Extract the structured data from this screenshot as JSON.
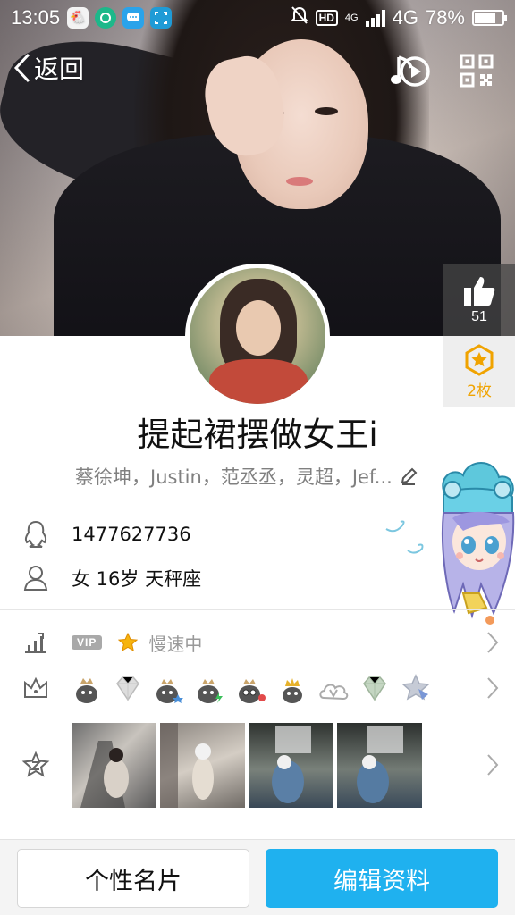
{
  "status_bar": {
    "time": "13:05",
    "hd": "HD",
    "network_small": "4G",
    "network": "4G",
    "battery": "78%",
    "battery_level": 0.78
  },
  "nav": {
    "back_label": "返回"
  },
  "side": {
    "like_count": "51",
    "badge_count": "2枚"
  },
  "profile": {
    "nickname": "提起裙摆做女王i",
    "tags": "蔡徐坤，Justin，范丞丞，灵超，Jef..."
  },
  "info": {
    "qq_number": "1477627736",
    "gender_age_sign": "女  16岁  天秤座"
  },
  "features": {
    "vip_label": "VIP",
    "speed_text": "慢速中"
  },
  "badges": [
    {
      "icon": "penguin-crown-badge-icon"
    },
    {
      "icon": "diamond-badge-icon"
    },
    {
      "icon": "penguin-star-badge-icon"
    },
    {
      "icon": "penguin-lightning-badge-icon"
    },
    {
      "icon": "penguin-glasses-badge-icon"
    },
    {
      "icon": "penguin-gold-crown-badge-icon"
    },
    {
      "icon": "cloud-v-badge-icon"
    },
    {
      "icon": "green-diamond-badge-icon"
    },
    {
      "icon": "star-badge-icon"
    }
  ],
  "bottom": {
    "card_button": "个性名片",
    "edit_button": "编辑资料"
  },
  "colors": {
    "accent": "#1fb1ef",
    "badge_gold": "#f0a300"
  }
}
